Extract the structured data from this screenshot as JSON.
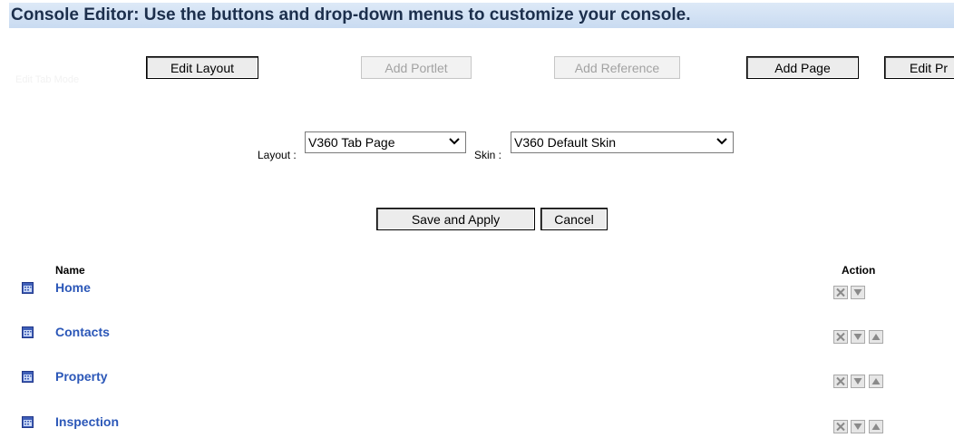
{
  "header": {
    "title": "Console Editor: Use the buttons and drop-down menus to customize your console."
  },
  "faint_label": "Edit Tab Mode",
  "toolbar": {
    "edit_layout": "Edit Layout",
    "add_portlet": "Add Portlet",
    "add_reference": "Add Reference",
    "add_page": "Add Page",
    "edit_profile": "Edit Pr"
  },
  "form": {
    "layout_label": "Layout :",
    "layout_value": "V360 Tab Page",
    "skin_label": "Skin :",
    "skin_value": "V360 Default Skin"
  },
  "actions": {
    "save_label": "Save and Apply",
    "cancel_label": "Cancel"
  },
  "table": {
    "name_header": "Name",
    "action_header": "Action",
    "rows": [
      {
        "name": "Home",
        "actions": [
          "remove",
          "move-down"
        ]
      },
      {
        "name": "Contacts",
        "actions": [
          "remove",
          "move-down",
          "move-up"
        ]
      },
      {
        "name": "Property",
        "actions": [
          "remove",
          "move-down",
          "move-up"
        ]
      },
      {
        "name": "Inspection",
        "actions": [
          "remove",
          "move-down",
          "move-up"
        ]
      }
    ]
  },
  "colors": {
    "header_bg": "#c9dbf1",
    "header_text": "#1c2f4c",
    "link": "#2b57b8",
    "disabled_text": "#a2a2a2"
  },
  "icons": {
    "row_icon": "page-icon",
    "remove": "remove-icon",
    "move_down": "move-down-icon",
    "move_up": "move-up-icon",
    "select_arrow": "chevron-down-icon"
  }
}
